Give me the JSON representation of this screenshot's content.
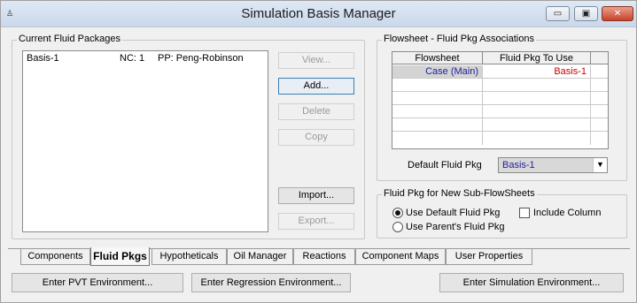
{
  "window": {
    "title": "Simulation Basis Manager",
    "icon": "app-icon",
    "controls": {
      "minimize": "▭",
      "maximize": "▣",
      "close": "✕"
    }
  },
  "fluid_packages": {
    "legend": "Current Fluid Packages",
    "items": [
      {
        "name": "Basis-1",
        "nc": "NC: 1",
        "pp": "PP: Peng-Robinson"
      }
    ],
    "buttons": {
      "view": "View...",
      "add": "Add...",
      "delete": "Delete",
      "copy": "Copy",
      "import": "Import...",
      "export": "Export..."
    }
  },
  "associations": {
    "legend": "Flowsheet - Fluid Pkg Associations",
    "columns": [
      "Flowsheet",
      "Fluid Pkg To Use"
    ],
    "rows": [
      {
        "flowsheet": "Case (Main)",
        "fluid_pkg": "Basis-1"
      }
    ],
    "default_label": "Default Fluid Pkg",
    "default_value": "Basis-1",
    "colors": {
      "flowsheet_text": "#1f1f9a",
      "pkg_text": "#cc0000"
    }
  },
  "subflowsheets": {
    "legend": "Fluid Pkg for New Sub-FlowSheets",
    "options": [
      "Use Default Fluid Pkg",
      "Use Parent's Fluid Pkg"
    ],
    "selected_index": 0,
    "include_column": "Include Column"
  },
  "tabs": [
    "Components",
    "Fluid Pkgs",
    "Hypotheticals",
    "Oil Manager",
    "Reactions",
    "Component Maps",
    "User Properties"
  ],
  "active_tab": "Fluid Pkgs",
  "bottom_buttons": {
    "pvt": "Enter PVT Environment...",
    "regression": "Enter Regression Environment...",
    "simulation": "Enter Simulation Environment..."
  }
}
